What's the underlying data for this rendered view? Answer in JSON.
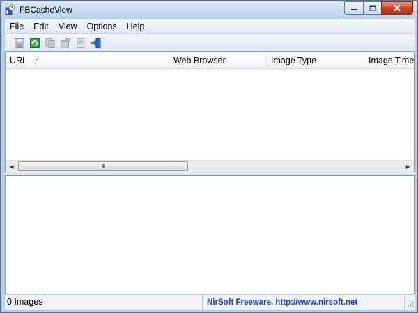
{
  "window": {
    "title": "FBCacheView",
    "app_icon": "fbcacheview-app-icon",
    "controls": [
      "minimize-icon",
      "maximize-icon",
      "close-icon"
    ]
  },
  "menubar": {
    "items": [
      {
        "label": "File"
      },
      {
        "label": "Edit"
      },
      {
        "label": "View"
      },
      {
        "label": "Options"
      },
      {
        "label": "Help"
      }
    ]
  },
  "toolbar": {
    "buttons": [
      {
        "icon": "save-icon"
      },
      {
        "icon": "refresh-icon"
      },
      {
        "icon": "copy-icon"
      },
      {
        "icon": "properties-icon"
      },
      {
        "icon": "report-icon"
      },
      {
        "icon": "exit-icon"
      }
    ]
  },
  "list": {
    "columns": [
      {
        "label": "URL",
        "sorted": true
      },
      {
        "label": "Web Browser"
      },
      {
        "label": "Image Type"
      },
      {
        "label": "Image Time"
      }
    ],
    "rows": [],
    "scrollbar_thumb_grip": "III"
  },
  "status": {
    "count_text": "0 Images",
    "credit_text": "NirSoft Freeware.  http://www.nirsoft.net"
  },
  "colors": {
    "link": "#1a3fd1",
    "close_button": "#c6462c",
    "frame": "#b8cfea"
  }
}
